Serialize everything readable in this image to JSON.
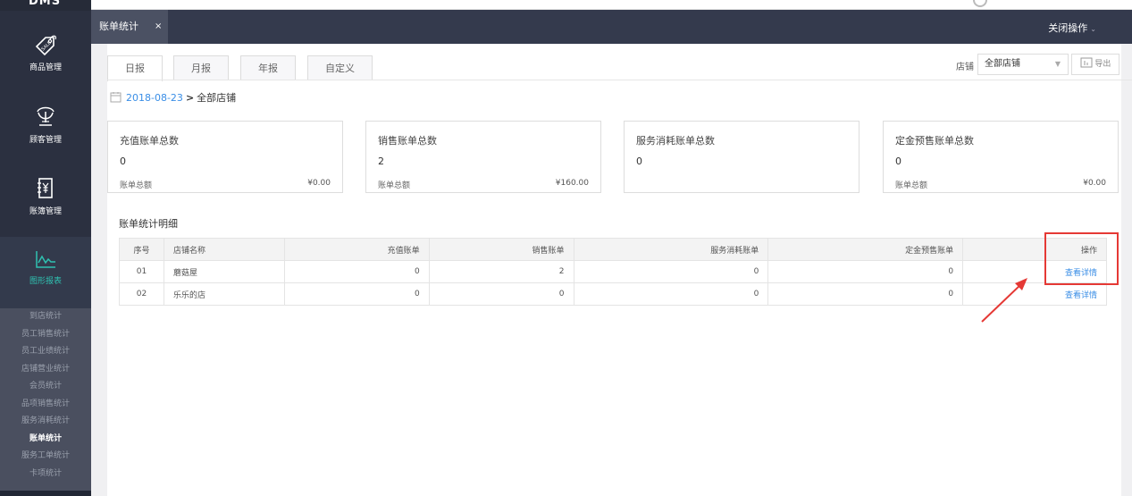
{
  "sidebar": {
    "brand": "DMS",
    "items": [
      {
        "label": "商品管理",
        "icon": "sale-tag-icon"
      },
      {
        "label": "顾客管理",
        "icon": "crown-icon"
      },
      {
        "label": "账簿管理",
        "icon": "ledger-icon"
      },
      {
        "label": "图形报表",
        "icon": "chart-line-icon"
      }
    ],
    "submenu": [
      "到店统计",
      "员工销售统计",
      "员工业绩统计",
      "店铺营业统计",
      "会员统计",
      "品项销售统计",
      "服务消耗统计",
      "账单统计",
      "服务工单统计",
      "卡项统计"
    ],
    "submenu_current": "账单统计"
  },
  "tabbar": {
    "active_tab": "账单统计",
    "close_symbol": "×",
    "close_ops": "关闭操作",
    "close_ops_caret": "⌄"
  },
  "report_tabs": [
    "日报",
    "月报",
    "年报",
    "自定义"
  ],
  "filter": {
    "store_label": "店铺",
    "store_value": "全部店铺",
    "export_label": "导出"
  },
  "date_line": {
    "date": "2018-08-23",
    "arrow": ">",
    "scope": "全部店铺"
  },
  "cards": [
    {
      "title": "充值账单总数",
      "count": "0",
      "sub_label": "账单总额",
      "amount": "¥0.00"
    },
    {
      "title": "销售账单总数",
      "count": "2",
      "sub_label": "账单总额",
      "amount": "¥160.00"
    },
    {
      "title": "服务消耗账单总数",
      "count": "0",
      "sub_label": "",
      "amount": ""
    },
    {
      "title": "定金预售账单总数",
      "count": "0",
      "sub_label": "账单总额",
      "amount": "¥0.00"
    }
  ],
  "table": {
    "title": "账单统计明细",
    "headers": [
      "序号",
      "店铺名称",
      "充值账单",
      "销售账单",
      "服务消耗账单",
      "定金预售账单",
      "操作"
    ],
    "rows": [
      [
        "01",
        "蘑菇屋",
        "0",
        "2",
        "0",
        "0",
        "查看详情"
      ],
      [
        "02",
        "乐乐的店",
        "0",
        "0",
        "0",
        "0",
        "查看详情"
      ]
    ]
  },
  "colors": {
    "sidebar_bg": "#2b3040",
    "accent": "#2fc1b1",
    "link": "#3a8ee6",
    "annotation_red": "#e53935"
  }
}
